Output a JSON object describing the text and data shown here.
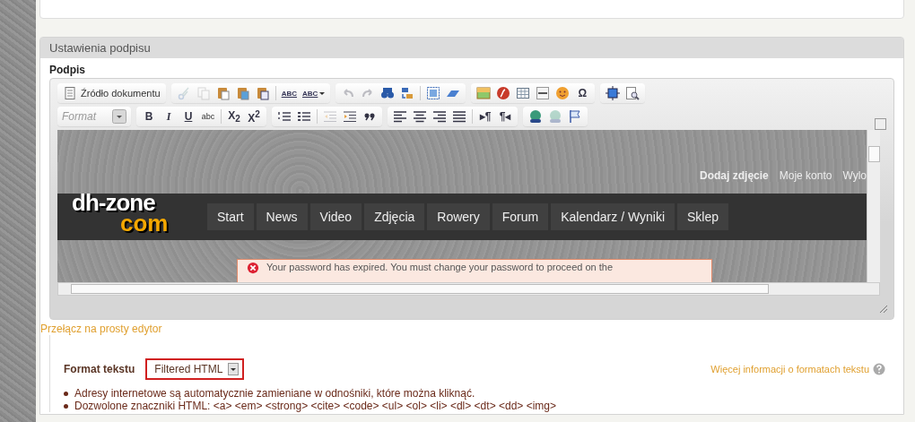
{
  "section": {
    "title": "Ustawienia podpisu"
  },
  "field_label": "Podpis",
  "editor": {
    "toolbar_rows": [
      {
        "groups": [
          {
            "items": [
              {
                "kind": "source",
                "label": "Źródło dokumentu",
                "disabled": false
              }
            ]
          },
          {
            "items": [
              {
                "kind": "cut",
                "disabled": true
              },
              {
                "kind": "copy",
                "disabled": true
              },
              {
                "kind": "paste",
                "disabled": false
              },
              {
                "kind": "paste-text",
                "disabled": false
              },
              {
                "kind": "paste-word",
                "disabled": false
              },
              {
                "kind": "separator"
              },
              {
                "kind": "spell",
                "label": "ABC",
                "disabled": false
              },
              {
                "kind": "spell-menu",
                "label": "ABC",
                "disabled": false
              }
            ]
          },
          {
            "items": [
              {
                "kind": "undo",
                "disabled": true
              },
              {
                "kind": "redo",
                "disabled": true
              },
              {
                "kind": "find",
                "disabled": false
              },
              {
                "kind": "replace",
                "disabled": false
              },
              {
                "kind": "separator"
              },
              {
                "kind": "select-all",
                "disabled": false
              },
              {
                "kind": "eraser",
                "disabled": false
              }
            ]
          },
          {
            "items": [
              {
                "kind": "image",
                "disabled": false
              },
              {
                "kind": "flash",
                "disabled": false
              },
              {
                "kind": "table",
                "disabled": false
              },
              {
                "kind": "rule",
                "disabled": false
              },
              {
                "kind": "smiley",
                "disabled": false
              },
              {
                "kind": "text",
                "label": "Ω",
                "disabled": false
              }
            ]
          },
          {
            "items": [
              {
                "kind": "maximize",
                "disabled": false
              },
              {
                "kind": "preview",
                "disabled": false
              }
            ]
          }
        ]
      },
      {
        "groups": [
          {
            "items": [
              {
                "kind": "format",
                "label": "Format",
                "disabled": false
              }
            ]
          },
          {
            "items": [
              {
                "kind": "bold",
                "label": "B",
                "disabled": false
              },
              {
                "kind": "italic",
                "label": "I",
                "disabled": false
              },
              {
                "kind": "underline",
                "label": "U",
                "disabled": false
              },
              {
                "kind": "strike",
                "label": "abc",
                "disabled": false
              },
              {
                "kind": "separator"
              },
              {
                "kind": "text",
                "label": "X$_{2}$",
                "disabled": false
              },
              {
                "kind": "text",
                "label": "X$^{2}$",
                "disabled": false
              }
            ]
          },
          {
            "items": [
              {
                "kind": "ordered-list",
                "disabled": false
              },
              {
                "kind": "bullet-list",
                "disabled": false
              },
              {
                "kind": "separator"
              },
              {
                "kind": "outdent",
                "disabled": true
              },
              {
                "kind": "indent",
                "disabled": false
              },
              {
                "kind": "quote",
                "disabled": false
              }
            ]
          },
          {
            "items": [
              {
                "kind": "align-left",
                "disabled": false
              },
              {
                "kind": "align-center",
                "disabled": false
              },
              {
                "kind": "align-right",
                "disabled": false
              },
              {
                "kind": "justify",
                "disabled": false
              },
              {
                "kind": "separator"
              },
              {
                "kind": "text",
                "label": "▸¶",
                "disabled": false
              },
              {
                "kind": "text",
                "label": "¶◂",
                "disabled": false
              }
            ]
          },
          {
            "items": [
              {
                "kind": "link",
                "disabled": false
              },
              {
                "kind": "unlink",
                "disabled": true
              },
              {
                "kind": "anchor",
                "disabled": false
              }
            ]
          }
        ]
      }
    ],
    "preview": {
      "logo": {
        "line_1": "dh-zone",
        "line_2": "com"
      },
      "user_links": [
        {
          "label": "Dodaj zdjęcie",
          "bold": true
        },
        {
          "label": "Moje konto",
          "bold": false
        },
        {
          "label": "Wylo",
          "bold": false
        }
      ],
      "nav": [
        "Start",
        "News",
        "Video",
        "Zdjęcia",
        "Rowery",
        "Forum",
        "Kalendarz / Wyniki",
        "Sklep"
      ],
      "alert": "Your password has expired. You must change your password to proceed on the"
    }
  },
  "switch_link": "Przełącz na prosty edytor",
  "text_format": {
    "label": "Format tekstu",
    "value": "Filtered HTML",
    "help_link": "Więcej informacji o formatach tekstu",
    "tips": [
      "Adresy internetowe są automatycznie zamieniane w odnośniki, które można kliknąć.",
      "Dozwolone znaczniki HTML: <a> <em> <strong> <cite> <code> <ul> <ol> <li> <dl> <dt> <dd> <img>"
    ]
  }
}
